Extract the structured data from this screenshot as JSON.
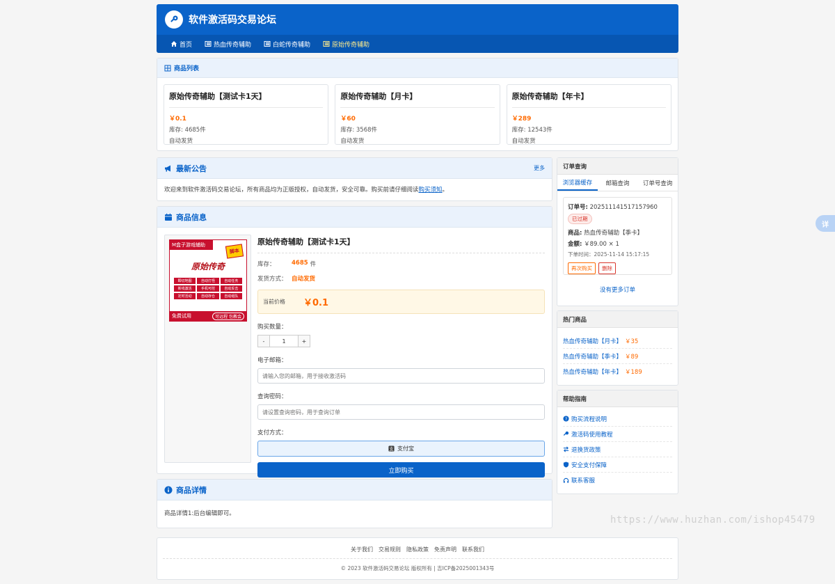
{
  "site": {
    "title": "软件激活码交易论坛",
    "nav": [
      "首页",
      "热血传奇辅助",
      "白蛇传奇辅助",
      "原始传奇辅助"
    ]
  },
  "product_list": {
    "heading": "商品列表",
    "items": [
      {
        "name": "原始传奇辅助【测试卡1天】",
        "price": "￥0.1",
        "stock": "库存: 4685件",
        "delivery": "自动发货"
      },
      {
        "name": "原始传奇辅助【月卡】",
        "price": "￥60",
        "stock": "库存: 3568件",
        "delivery": "自动发货"
      },
      {
        "name": "原始传奇辅助【年卡】",
        "price": "￥289",
        "stock": "库存: 12543件",
        "delivery": "自动发货"
      }
    ]
  },
  "notice": {
    "heading": "最新公告",
    "more": "更多",
    "text": "欢迎来到软件激活码交易论坛，所有商品均为正版授权，自动发货，安全可靠。购买前请仔细阅读",
    "link": "购买须知",
    "end": "。"
  },
  "product_info": {
    "heading": "商品信息",
    "title": "原始传奇辅助【测试卡1天】",
    "stock_label": "库存：",
    "stock_value": "4685",
    "stock_unit": "件",
    "delivery_label": "发货方式：",
    "delivery_value": "自动发货",
    "price_label": "当前价格",
    "price_value": "￥0.1",
    "qty_label": "购买数量：",
    "qty_minus": "-",
    "qty_value": "1",
    "qty_plus": "+",
    "email_label": "电子邮箱：",
    "email_placeholder": "请输入您的邮箱，用于接收激活码",
    "pwd_label": "查询密码：",
    "pwd_placeholder": "请设置查询密码，用于查询订单",
    "pay_label": "支付方式：",
    "pay_option": "支付宝",
    "buy_button": "立即购买",
    "poster": {
      "top": "M盒子游戏辅助",
      "badge": "脚本",
      "art": "原始传奇",
      "tags": [
        "瞬切地图",
        "自动打怪",
        "自动任务",
        "新线激活",
        "手机可控",
        "自动反击",
        "定时活动",
        "自动存仓",
        "自动组队"
      ],
      "left": "免费试用",
      "right": "可远程 包教会"
    }
  },
  "details": {
    "heading": "商品详情",
    "text": "商品详情1:后台编辑即可。"
  },
  "order_query": {
    "heading": "订单查询",
    "tabs": [
      "浏览器缓存",
      "邮箱查询",
      "订单号查询"
    ],
    "order_no_label": "订单号:",
    "order_no": "202511141517157960",
    "status": "已过期",
    "product_label": "商品:",
    "product": "热血传奇辅助【季卡】",
    "amount_label": "金额:",
    "amount": "￥89.00 × 1",
    "time": "下单时间：2025-11-14 15:17:15",
    "again_button": "再次购买",
    "delete_button": "删除",
    "no_more": "没有更多订单"
  },
  "hot": {
    "heading": "热门商品",
    "items": [
      {
        "name": "热血传奇辅助【月卡】",
        "price": "￥35"
      },
      {
        "name": "热血传奇辅助【季卡】",
        "price": "￥89"
      },
      {
        "name": "热血传奇辅助【年卡】",
        "price": "￥189"
      }
    ]
  },
  "help": {
    "heading": "帮助指南",
    "items": [
      "购买流程说明",
      "激活码使用教程",
      "退换货政策",
      "安全支付保障",
      "联系客服"
    ]
  },
  "footer": {
    "links": [
      "关于我们",
      "交易规则",
      "隐私政策",
      "免责声明",
      "联系我们"
    ],
    "copyright": "© 2023 软件激活码交易论坛 版权所有 | 吉ICP备2025001343号"
  },
  "float_button": "详",
  "watermark": "https://www.huzhan.com/ishop45479",
  "colors": {
    "primary": "#0a63c9",
    "accent": "#ff6a00",
    "danger": "#d9362b"
  }
}
